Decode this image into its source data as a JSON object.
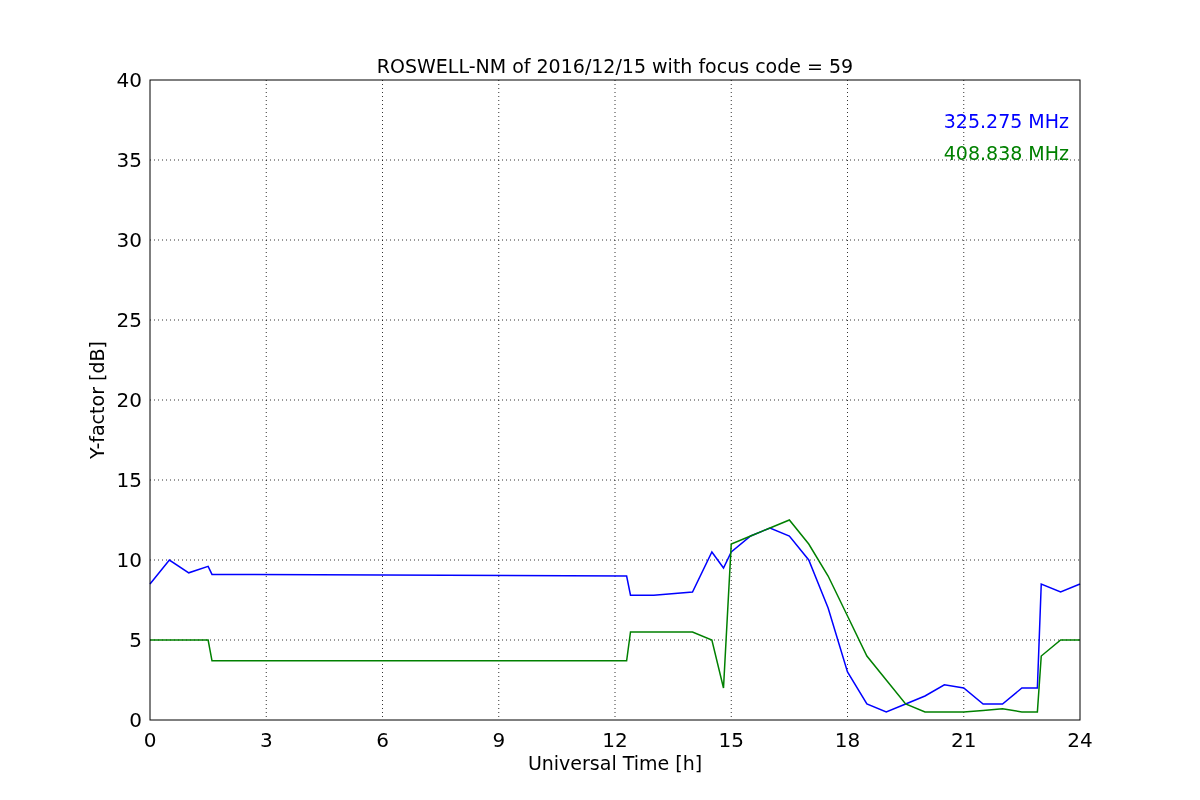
{
  "chart_data": {
    "type": "line",
    "title": "ROSWELL-NM of 2016/12/15 with focus code = 59",
    "xlabel": "Universal Time [h]",
    "ylabel": "Y-factor [dB]",
    "x": [
      0,
      0.5,
      1,
      1.5,
      1.6,
      12.3,
      12.4,
      13,
      14,
      14.5,
      14.8,
      15,
      15.5,
      16,
      16.5,
      17,
      17.5,
      18,
      18.5,
      19,
      19.5,
      20,
      20.5,
      21,
      21.5,
      22,
      22.5,
      22.9,
      23,
      23.5,
      24
    ],
    "series": [
      {
        "name": "325.275 MHz",
        "color": "#0000ff",
        "values": [
          8.5,
          10,
          9.2,
          9.6,
          9.1,
          9,
          7.8,
          7.8,
          8,
          10.5,
          9.5,
          10.5,
          11.5,
          12,
          11.5,
          10,
          7,
          3,
          1,
          0.5,
          1,
          1.5,
          2.2,
          2,
          1,
          1,
          2,
          2,
          8.5,
          8,
          8.5
        ]
      },
      {
        "name": "408.838 MHz",
        "color": "#008000",
        "values": [
          5,
          5,
          5,
          5,
          3.7,
          3.7,
          5.5,
          5.5,
          5.5,
          5,
          2,
          11,
          11.5,
          12,
          12.5,
          11,
          9,
          6.5,
          4,
          2.5,
          1,
          0.5,
          0.5,
          0.5,
          0.6,
          0.7,
          0.5,
          0.5,
          4,
          5,
          5
        ]
      }
    ],
    "grid": true,
    "xlim": [
      0,
      24
    ],
    "ylim": [
      0,
      40
    ],
    "xticks": [
      0,
      3,
      6,
      9,
      12,
      15,
      18,
      21,
      24
    ],
    "yticks": [
      0,
      5,
      10,
      15,
      20,
      25,
      30,
      35,
      40
    ]
  }
}
